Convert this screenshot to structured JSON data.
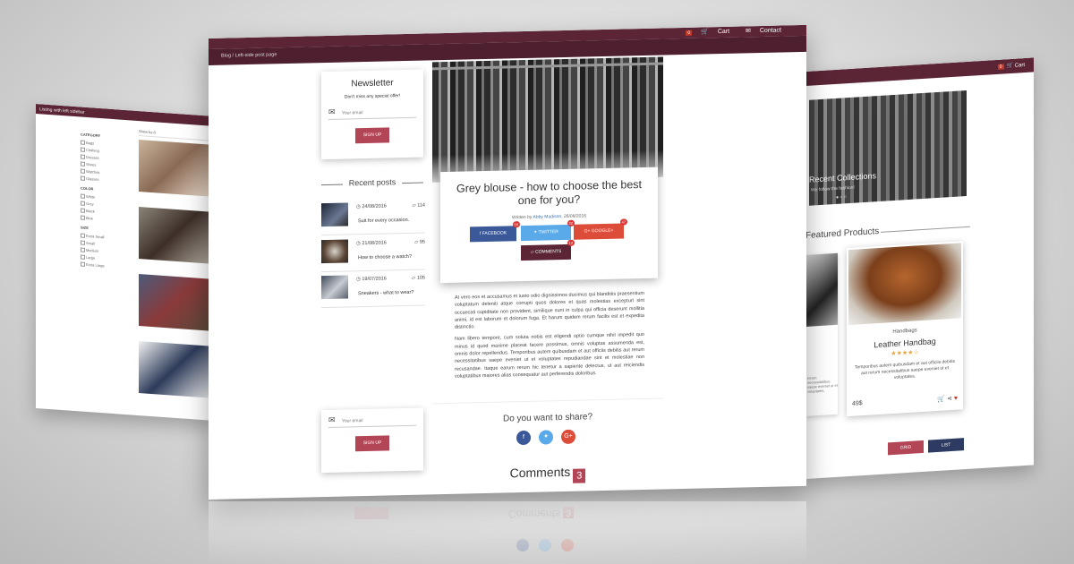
{
  "left_page": {
    "topbar_text": "Listing with left sidebar",
    "sort_label": "Show by 8",
    "filters": {
      "size_heading": "SIZE",
      "sizes": [
        "Extra Small",
        "Small",
        "Medium",
        "Large",
        "Extra Large"
      ],
      "color_heading": "COLOR",
      "colors": [
        "White",
        "Grey",
        "Black",
        "Blue"
      ],
      "category_heading": "CATEGORY",
      "categories": [
        "Bags",
        "Clothing",
        "Dresses",
        "Shoes",
        "Watches",
        "Glasses"
      ]
    }
  },
  "right_page": {
    "cart_badge": "0",
    "cart_label": "Cart",
    "hero_caption": "Recent Collections",
    "hero_sub": "We follow the fashion!",
    "featured_title": "Featured Products",
    "product": {
      "category": "Handbags",
      "name": "Leather Handbag",
      "stars": "★★★★☆",
      "description": "Temporibus autem quibusdam et aut officiis debitis aut rerum necessitatibus saepe eveniet ut et voluptates.",
      "price": "49$"
    },
    "left_card_text": "rerum necessitatibus saepe eveniet ut et voluptates.",
    "grid_button": "GRID",
    "list_button": "LIST"
  },
  "main_page": {
    "topbar": {
      "cart_badge": "0",
      "cart_label": "Cart",
      "contact_label": "Contact"
    },
    "breadcrumb": "Blog / Left-side post page",
    "newsletter": {
      "title": "Newsletter",
      "subtitle": "Don't miss any special offer!",
      "email_placeholder": "Your email",
      "button": "SIGN UP"
    },
    "recent_posts_title": "Recent posts",
    "recent_posts": [
      {
        "date": "24/08/2016",
        "comments": "114",
        "title": "Suit for every occasion."
      },
      {
        "date": "21/08/2016",
        "comments": "95",
        "title": "How to choose a watch?"
      },
      {
        "date": "19/07/2016",
        "comments": "105",
        "title": "Sneakers - what to wear?"
      }
    ],
    "post": {
      "title": "Grey blouse - how to choose the best one for you?",
      "written_by": "Written by",
      "author": "Abby Madison",
      "date": ", 26/08/2016",
      "share_buttons": [
        {
          "label": "FACEBOOK",
          "count": "59"
        },
        {
          "label": "TWITTER",
          "count": "32"
        },
        {
          "label": "GOOGLE+",
          "count": "47"
        }
      ],
      "comments_button": "COMMENTS",
      "comments_badge": "13",
      "paragraph_1": "At vero eos et accusamus et iusto odio dignissimos ducimus qui blanditiis praesentium voluptatum deleniti atque corrupti quos dolores et quas molestias excepturi sint occaecati cupiditate non provident, similique sunt in culpa qui officia deserunt mollitia animi, id est laborum et dolorum fuga. Et harum quidem rerum facilis est et expedita distinctio.",
      "paragraph_2": "Nam libero tempore, cum soluta nobis est eligendi optio cumque nihil impedit quo minus id quod maxime placeat facere possimus, omnis voluptas assumenda est, omnis dolor repellendus. Temporibus autem quibusdam et aut officiis debitis aut rerum necessitatibus saepe eveniet ut et voluptates repudiandae sint et molestiae non recusandae. Itaque earum rerum hic tenetur a sapiente delectus, ut aut reiciendis voluptatibus maiores alias consequatur aut perferendis doloribus."
    },
    "newsletter_bottom": {
      "email_placeholder": "Your email",
      "button": "SIGN UP"
    },
    "share_question": "Do you want to share?",
    "comments_title": "Comments",
    "comments_count": "3",
    "icons": [
      "envelope-icon",
      "clock-icon",
      "comment-icon",
      "cart-icon",
      "facebook-icon",
      "twitter-icon",
      "google-plus-icon"
    ]
  }
}
